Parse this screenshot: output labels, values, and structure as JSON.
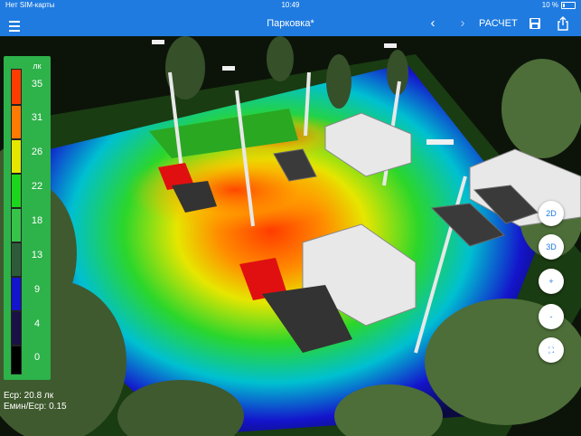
{
  "status": {
    "carrier": "Нет SIM-карты",
    "time": "10:49",
    "battery": "10 %"
  },
  "nav": {
    "title": "Парковка*",
    "calc_label": "РАСЧЕТ"
  },
  "legend": {
    "unit": "лк",
    "levels": [
      {
        "label": "35",
        "color": "#ff3c00"
      },
      {
        "label": "31",
        "color": "#ff7a00"
      },
      {
        "label": "26",
        "color": "#e6e600"
      },
      {
        "label": "22",
        "color": "#1bd61b"
      },
      {
        "label": "18",
        "color": "#37c24a"
      },
      {
        "label": "13",
        "color": "#2f5a3a"
      },
      {
        "label": "9",
        "color": "#1414cc"
      },
      {
        "label": "4",
        "color": "#1a1245"
      },
      {
        "label": "0",
        "color": "#000000"
      }
    ]
  },
  "stats": {
    "avg": "Еср:  20.8 лк",
    "ratio": "Емин/Еср:  0.15"
  },
  "view_buttons": {
    "btn_2d": "2D",
    "btn_3d": "3D",
    "zoom_in": "+",
    "zoom_out": "-",
    "fit": "⛶"
  }
}
